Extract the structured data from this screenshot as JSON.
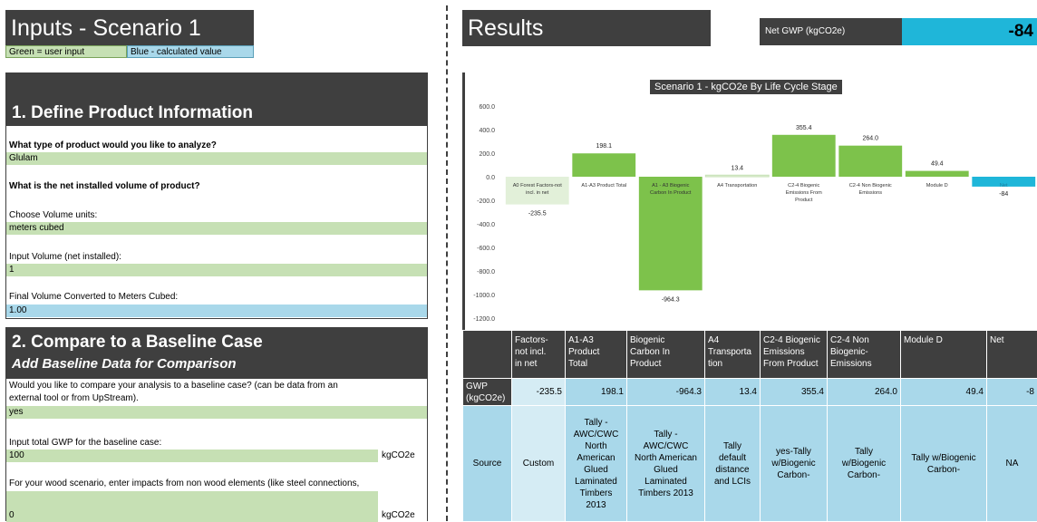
{
  "inputs": {
    "title": "Inputs - Scenario 1",
    "legend_green": "Green = user input",
    "legend_blue": "Blue - calculated value",
    "section1": {
      "heading": "1. Define Product Information",
      "q_product_type": "What type of product would you like to analyze?",
      "product_type_value": "Glulam",
      "q_net_volume": "What is the net installed volume of product?",
      "label_volume_units": "Choose Volume units:",
      "volume_units_value": "meters cubed",
      "label_input_volume": "Input Volume (net installed):",
      "input_volume_value": "1",
      "label_final_volume": "Final Volume Converted to Meters Cubed:",
      "final_volume_value": "1.00"
    },
    "section2": {
      "heading": "2. Compare to a Baseline Case",
      "subheading": "Add Baseline Data for Comparison",
      "q_compare_line1": "Would you like to compare your analysis to a baseline case? (can be data from an",
      "q_compare_line2": "external tool or from UpStream).",
      "compare_value": "yes",
      "label_baseline_gwp": "Input total GWP for the baseline case:",
      "baseline_gwp_value": "100",
      "baseline_gwp_unit": "kgCO2e",
      "label_non_wood": "For your wood scenario, enter impacts from non wood elements (like steel connections,",
      "non_wood_value": "0",
      "non_wood_unit": "kgCO2e"
    }
  },
  "results": {
    "title": "Results",
    "net_gwp_label": "Net GWP (kgCO2e)",
    "net_gwp_value": "-84",
    "colors": {
      "green": "#7dc24b",
      "light_green": "#e2f0d9",
      "blue": "#1fb6d9",
      "dark": "#3f3f3f"
    }
  },
  "chart_data": {
    "type": "bar",
    "title": "Scenario 1 - kgCO2e By Life Cycle Stage",
    "ylim": [
      -1200,
      600
    ],
    "yticks": [
      "600.0",
      "400.0",
      "200.0",
      "0.0",
      "-200.0",
      "-400.0",
      "-600.0",
      "-800.0",
      "-1000.0",
      "-1200.0"
    ],
    "grid": false,
    "categories": [
      [
        "A0 Forest Factors-not",
        "incl. in net"
      ],
      [
        "A1-A3 Product Total"
      ],
      [
        "A1 - A3 Biogenic",
        "Carbon In Product"
      ],
      [
        "A4 Transportation"
      ],
      [
        "C2-4 Biogenic",
        "Emissions From",
        "Product"
      ],
      [
        "C2-4 Non Biogenic",
        "Emissions"
      ],
      [
        "Module D"
      ],
      [
        "Net"
      ]
    ],
    "values": [
      -235.5,
      198.1,
      -964.3,
      13.4,
      355.4,
      264.0,
      49.4,
      -84
    ],
    "value_labels": [
      "-235.5",
      "198.1",
      "-964.3",
      "13.4",
      "355.4",
      "264.0",
      "49.4",
      "-84"
    ],
    "bar_colors": [
      "#e2f0d9",
      "#7dc24b",
      "#7dc24b",
      "#e2f0d9",
      "#7dc24b",
      "#7dc24b",
      "#7dc24b",
      "#1fb6d9"
    ]
  },
  "table": {
    "headers": [
      "",
      "Factors-\nnot incl.\nin net",
      "A1-A3\nProduct\nTotal",
      "Biogenic\nCarbon In\nProduct",
      "A4\nTransporta\ntion",
      "C2-4 Biogenic\nEmissions\nFrom Product",
      "C2-4 Non\nBiogenic-\nEmissions",
      "Module D",
      "Net"
    ],
    "gwp_label": "GWP\n(kgCO2e)",
    "gwp_values": [
      "-235.5",
      "198.1",
      "-964.3",
      "13.4",
      "355.4",
      "264.0",
      "49.4",
      "-8"
    ],
    "source_label": "Source",
    "source_values": [
      "Custom",
      "Tally -\nAWC/CWC\nNorth\nAmerican\nGlued\nLaminated\nTimbers\n2013",
      "Tally -\nAWC/CWC\nNorth American\nGlued\nLaminated\nTimbers 2013",
      "Tally\ndefault\ndistance\nand LCIs",
      "yes-Tally\nw/Biogenic\nCarbon-",
      "Tally\nw/Biogenic\nCarbon-",
      "Tally w/Biogenic\nCarbon-",
      "NA"
    ]
  }
}
